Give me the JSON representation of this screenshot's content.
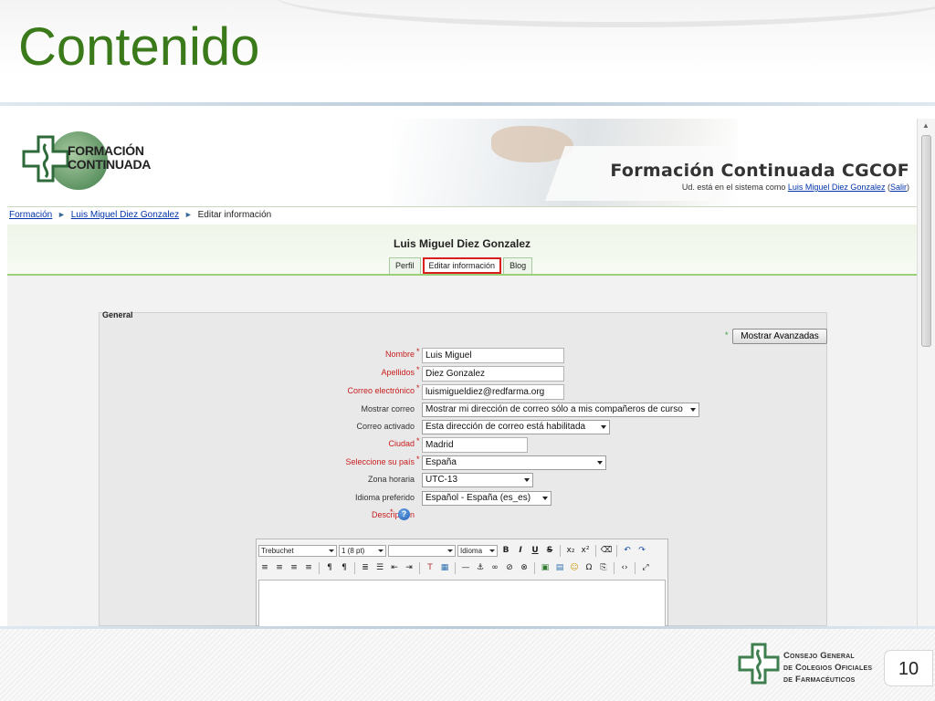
{
  "slide": {
    "title": "Contenido",
    "page_number": "10",
    "footer_logo_lines": [
      "Consejo General",
      "de Colegios Oficiales",
      "de Farmacéuticos"
    ]
  },
  "site": {
    "logo_lines": [
      "FORMACIÓN",
      "CONTINUADA"
    ],
    "title": "Formación Continuada CGCOF",
    "login_prefix": "Ud. está en el sistema como",
    "login_user": "Luis Miguel Diez Gonzalez",
    "logout_open": "(",
    "logout_label": "Salir",
    "logout_close": ")"
  },
  "breadcrumb": {
    "items": [
      "Formación",
      "Luis Miguel Diez Gonzalez",
      "Editar información"
    ],
    "separator": "►"
  },
  "profile": {
    "user_name": "Luis Miguel Diez Gonzalez",
    "tabs": [
      {
        "label": "Perfil",
        "active": false
      },
      {
        "label": "Editar información",
        "active": true
      },
      {
        "label": "Blog",
        "active": false
      }
    ]
  },
  "form": {
    "legend": "General",
    "advanced_star": "*",
    "advanced_button": "Mostrar Avanzadas",
    "required_star": "*",
    "fields": [
      {
        "label": "Nombre",
        "value": "Luis Miguel",
        "required": true,
        "kind": "input"
      },
      {
        "label": "Apellidos",
        "value": "Diez Gonzalez",
        "required": true,
        "kind": "input"
      },
      {
        "label": "Correo electrónico",
        "value": "luismigueldiez@redfarma.org",
        "required": true,
        "kind": "input"
      },
      {
        "label": "Mostrar correo",
        "value": "Mostrar mi dirección de correo sólo a mis compañeros de curso",
        "required": false,
        "kind": "select"
      },
      {
        "label": "Correo activado",
        "value": "Esta dirección de correo está habilitada",
        "required": false,
        "kind": "select"
      },
      {
        "label": "Ciudad",
        "value": "Madrid",
        "required": true,
        "kind": "input"
      },
      {
        "label": "Seleccione su país",
        "value": "España",
        "required": true,
        "kind": "select"
      },
      {
        "label": "Zona horaria",
        "value": "UTC-13",
        "required": false,
        "kind": "select"
      },
      {
        "label": "Idioma preferido",
        "value": "Español - España (es_es)",
        "required": false,
        "kind": "select"
      },
      {
        "label": "Descripción",
        "value": "",
        "required": true,
        "kind": "help"
      }
    ],
    "help_glyph": "?"
  },
  "editor": {
    "font_family": "Trebuchet",
    "font_size": "1 (8 pt)",
    "style": "",
    "language": "Idioma",
    "row1_icons": [
      "bold-icon",
      "italic-icon",
      "underline-icon",
      "strikethrough-icon",
      "subscript-icon",
      "superscript-icon",
      "clean-icon",
      "undo-icon",
      "redo-icon"
    ],
    "row1_glyphs": [
      "B",
      "I",
      "U",
      "S",
      "x₂",
      "x²",
      "⌫",
      "↶",
      "↷"
    ],
    "row2_icons": [
      "align-left-icon",
      "align-center-icon",
      "align-right-icon",
      "justify-icon",
      "ltr-icon",
      "rtl-icon",
      "ordered-list-icon",
      "unordered-list-icon",
      "outdent-icon",
      "indent-icon",
      "text-color-icon",
      "background-color-icon",
      "horizontal-rule-icon",
      "anchor-icon",
      "link-icon",
      "unlink-icon",
      "no-link-icon",
      "image-icon",
      "table-icon",
      "emoticon-icon",
      "special-char-icon",
      "search-replace-icon",
      "html-source-icon",
      "fullscreen-icon"
    ],
    "row2_glyphs": [
      "≡",
      "≡",
      "≡",
      "≡",
      "¶",
      "¶",
      "≣",
      "☰",
      "⇤",
      "⇥",
      "T",
      "▦",
      "—",
      "⚓",
      "∞",
      "⊘",
      "⊗",
      "▣",
      "▤",
      "☺",
      "Ω",
      "⎘",
      "‹›",
      "⤢"
    ]
  },
  "colors": {
    "slide_title": "#3a7a1a",
    "required_label": "#c81d1d",
    "link": "#0033aa",
    "active_tab_border": "#d81e1e",
    "band_border": "#9ccf7a"
  }
}
